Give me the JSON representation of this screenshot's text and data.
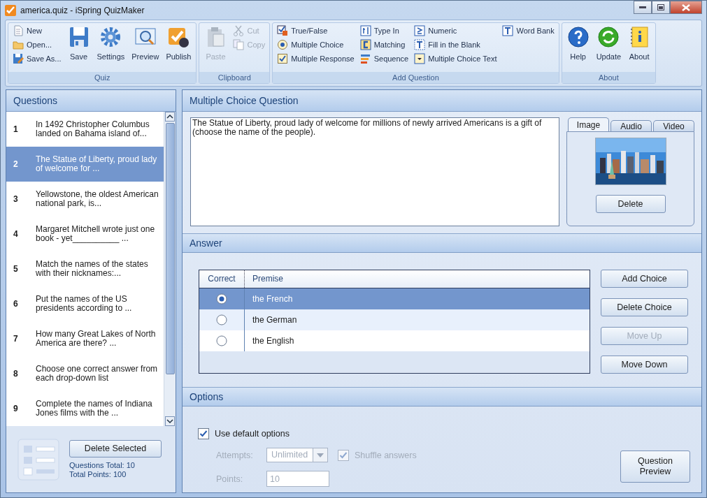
{
  "window": {
    "title": "america.quiz - iSpring QuizMaker"
  },
  "ribbon": [
    {
      "label": "Quiz",
      "items": [
        {
          "label": "New",
          "kind": "small",
          "disabled": false
        },
        {
          "label": "Open...",
          "kind": "small",
          "disabled": false
        },
        {
          "label": "Save As...",
          "kind": "small",
          "disabled": false
        },
        {
          "label": "Save",
          "kind": "large",
          "disabled": false
        },
        {
          "label": "Settings",
          "kind": "large",
          "disabled": false
        },
        {
          "label": "Preview",
          "kind": "large",
          "disabled": false
        },
        {
          "label": "Publish",
          "kind": "large",
          "disabled": false
        }
      ]
    },
    {
      "label": "Clipboard",
      "items": [
        {
          "label": "Paste",
          "kind": "large",
          "disabled": true
        },
        {
          "label": "Cut",
          "kind": "small",
          "disabled": true
        },
        {
          "label": "Copy",
          "kind": "small",
          "disabled": true
        }
      ]
    },
    {
      "label": "Add Question",
      "items": [
        {
          "label": "True/False",
          "kind": "small",
          "disabled": false
        },
        {
          "label": "Multiple Choice",
          "kind": "small",
          "disabled": false
        },
        {
          "label": "Multiple Response",
          "kind": "small",
          "disabled": false
        },
        {
          "label": "Type In",
          "kind": "small",
          "disabled": false
        },
        {
          "label": "Matching",
          "kind": "small",
          "disabled": false
        },
        {
          "label": "Sequence",
          "kind": "small",
          "disabled": false
        },
        {
          "label": "Numeric",
          "kind": "small",
          "disabled": false
        },
        {
          "label": "Fill in the Blank",
          "kind": "small",
          "disabled": false
        },
        {
          "label": "Multiple Choice Text",
          "kind": "small",
          "disabled": false
        },
        {
          "label": "Word Bank",
          "kind": "small",
          "disabled": false
        }
      ]
    },
    {
      "label": "About",
      "items": [
        {
          "label": "Help",
          "kind": "large",
          "disabled": false
        },
        {
          "label": "Update",
          "kind": "large",
          "disabled": false
        },
        {
          "label": "About",
          "kind": "large",
          "disabled": false
        }
      ]
    }
  ],
  "questions": {
    "title": "Questions",
    "items": [
      {
        "number": "1",
        "text": "In 1492 Christopher Columbus landed on Bahama island of...",
        "selected": false
      },
      {
        "number": "2",
        "text": "The Statue of Liberty, proud lady of welcome for ...",
        "selected": true
      },
      {
        "number": "3",
        "text": "Yellowstone, the oldest American national park, is...",
        "selected": false
      },
      {
        "number": "4",
        "text": "Margaret Mitchell wrote just one book - yet__________ ...",
        "selected": false
      },
      {
        "number": "5",
        "text": "Match the names of the states with their nicknames:...",
        "selected": false
      },
      {
        "number": "6",
        "text": "Put the names of the US presidents according to ...",
        "selected": false
      },
      {
        "number": "7",
        "text": "How many Great Lakes of North America are there? ...",
        "selected": false
      },
      {
        "number": "8",
        "text": "Choose one correct answer from each drop-down list",
        "selected": false
      },
      {
        "number": "9",
        "text": "Complete the names of Indiana Jones films with the ...",
        "selected": false
      }
    ],
    "delete_button": "Delete Selected",
    "questions_total": "Questions Total: 10",
    "total_points": "Total Points: 100"
  },
  "question": {
    "title": "Multiple Choice Question",
    "text": "The Statue of Liberty, proud lady of welcome for millions of newly arrived Americans is a gift of (choose the name of the people).",
    "media_tabs": [
      {
        "label": "Image",
        "selected": true
      },
      {
        "label": "Audio",
        "selected": false
      },
      {
        "label": "Video",
        "selected": false
      }
    ],
    "delete_button": "Delete"
  },
  "answer": {
    "title": "Answer",
    "columns": [
      "Correct",
      "Premise"
    ],
    "rows": [
      {
        "premise": "the French",
        "correct": true,
        "selected": true
      },
      {
        "premise": "the German",
        "correct": false,
        "selected": false
      },
      {
        "premise": "the English",
        "correct": false,
        "selected": false
      }
    ],
    "buttons": [
      {
        "label": "Add Choice",
        "disabled": false
      },
      {
        "label": "Delete Choice",
        "disabled": false
      },
      {
        "label": "Move Up",
        "disabled": true
      },
      {
        "label": "Move Down",
        "disabled": false
      }
    ]
  },
  "options": {
    "title": "Options",
    "use_default": {
      "label": "Use default options",
      "checked": true
    },
    "attempts": {
      "label": "Attempts:",
      "value": "Unlimited",
      "disabled": true
    },
    "shuffle": {
      "label": "Shuffle answers",
      "checked": true,
      "disabled": true
    },
    "points": {
      "label": "Points:",
      "value": "10",
      "disabled": true
    },
    "preview_button": "Question Preview"
  }
}
